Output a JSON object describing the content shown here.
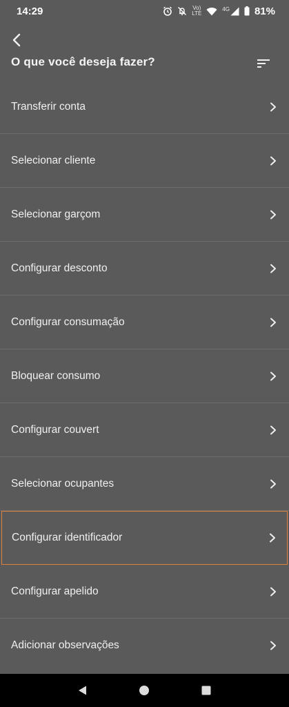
{
  "status_bar": {
    "time": "14:29",
    "network_top": "Vo)",
    "network_bottom": "LTE",
    "signal_label": "4G",
    "battery": "81%",
    "icons": [
      "alarm-icon",
      "mute-icon",
      "volte-icon",
      "wifi-icon",
      "signal-icon",
      "battery-icon"
    ]
  },
  "header": {
    "title": "O que você deseja fazer?",
    "back_icon": "back-arrow-icon",
    "sort_icon": "sort-icon"
  },
  "menu": {
    "items": [
      {
        "label": "Transferir conta"
      },
      {
        "label": "Selecionar cliente"
      },
      {
        "label": "Selecionar garçom"
      },
      {
        "label": "Configurar desconto"
      },
      {
        "label": "Configurar consumação"
      },
      {
        "label": "Bloquear consumo"
      },
      {
        "label": "Configurar couvert"
      },
      {
        "label": "Selecionar ocupantes"
      },
      {
        "label": "Configurar identificador",
        "selected": true
      },
      {
        "label": "Configurar apelido"
      },
      {
        "label": "Adicionar observações"
      }
    ]
  },
  "nav_bar": {
    "buttons": [
      "back-triangle-icon",
      "home-circle-icon",
      "recents-square-icon"
    ]
  },
  "colors": {
    "background": "#5a5a5a",
    "divider": "#6e6e6e",
    "selection_border": "#e0803c",
    "nav_background": "#000000"
  }
}
